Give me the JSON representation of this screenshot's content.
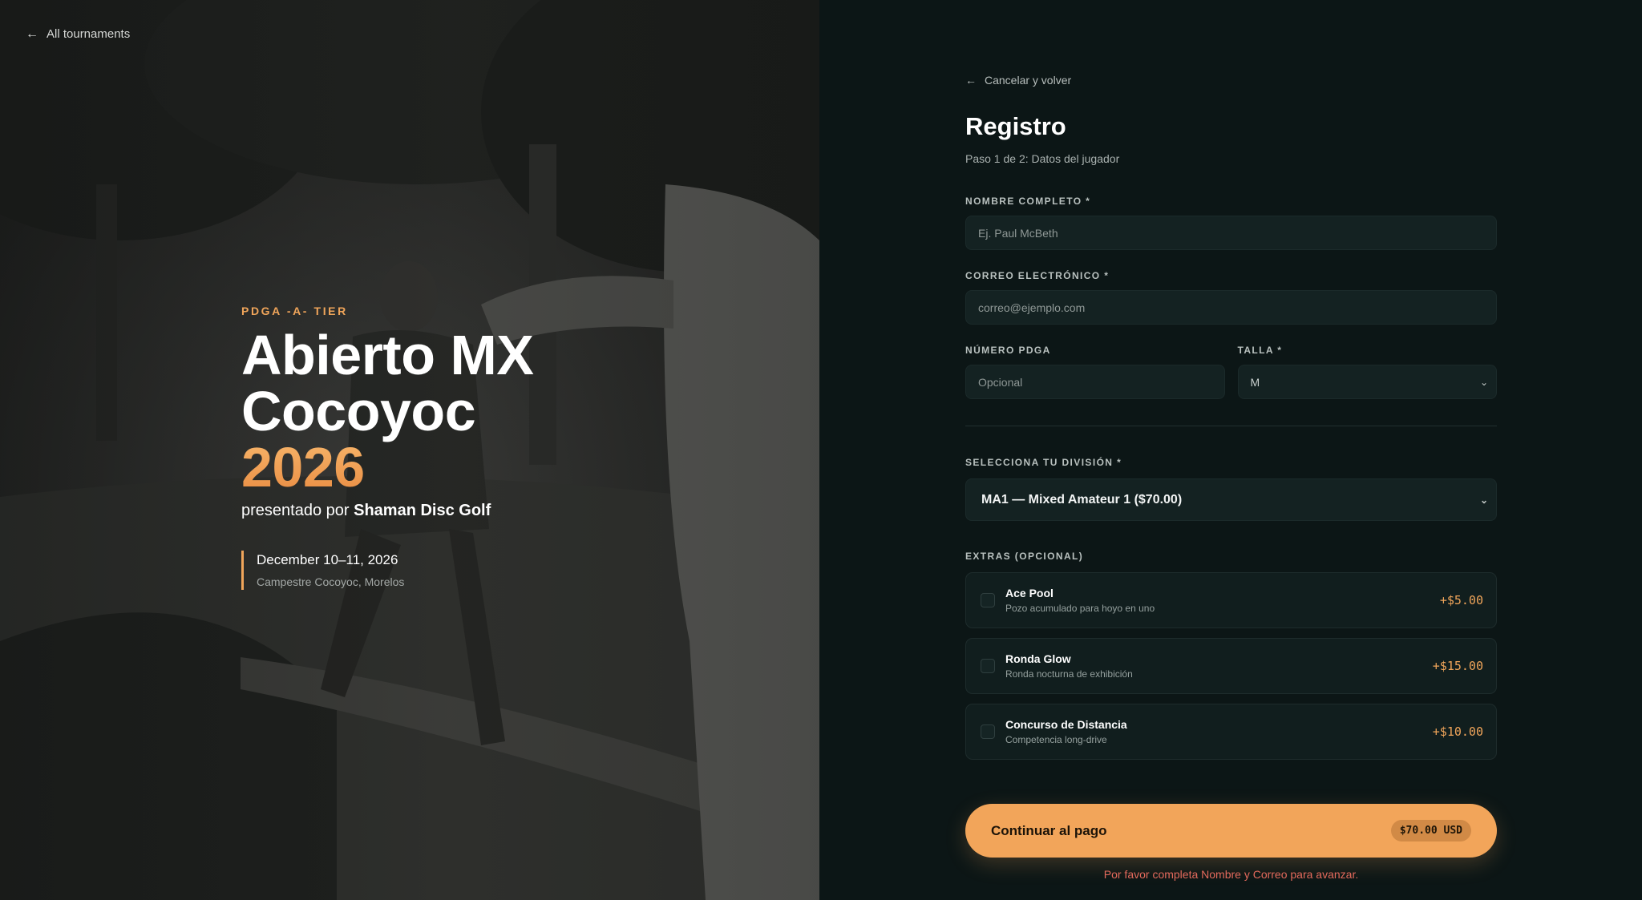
{
  "nav": {
    "back_label": "All tournaments"
  },
  "hero": {
    "tier": "PDGA -A- TIER",
    "title_line1": "Abierto MX",
    "title_line2": "Cocoyoc",
    "title_year": "2026",
    "presented_prefix": "presentado por",
    "presented_by": "Shaman Disc Golf",
    "date": "December 10–11, 2026",
    "venue": "Campestre Cocoyoc, Morelos"
  },
  "form": {
    "cancel_label": "Cancelar y volver",
    "title": "Registro",
    "step": "Paso 1 de 2: Datos del jugador",
    "name": {
      "label": "NOMBRE COMPLETO *",
      "placeholder": "Ej. Paul McBeth"
    },
    "email": {
      "label": "CORREO ELECTRÓNICO *",
      "placeholder": "correo@ejemplo.com"
    },
    "pdga": {
      "label": "NÚMERO PDGA",
      "placeholder": "Opcional"
    },
    "size": {
      "label": "TALLA *",
      "value": "M"
    },
    "division": {
      "label": "SELECCIONA TU DIVISIÓN *",
      "value": "MA1 — Mixed Amateur 1 ($70.00)"
    },
    "extras_label": "EXTRAS (OPCIONAL)",
    "extras": [
      {
        "name": "Ace Pool",
        "desc": "Pozo acumulado para hoyo en uno",
        "price": "+$5.00"
      },
      {
        "name": "Ronda Glow",
        "desc": "Ronda nocturna de exhibición",
        "price": "+$15.00"
      },
      {
        "name": "Concurso de Distancia",
        "desc": "Competencia long-drive",
        "price": "+$10.00"
      }
    ],
    "cta_label": "Continuar al pago",
    "cta_total": "$70.00 USD",
    "error": "Por favor completa Nombre y Correo para avanzar."
  },
  "colors": {
    "accent": "#f0a55a",
    "panel_bg": "#0c1616",
    "error": "#e46a5c"
  },
  "icons": {
    "back": "arrow-left-icon",
    "chevron": "chevron-down-icon"
  }
}
